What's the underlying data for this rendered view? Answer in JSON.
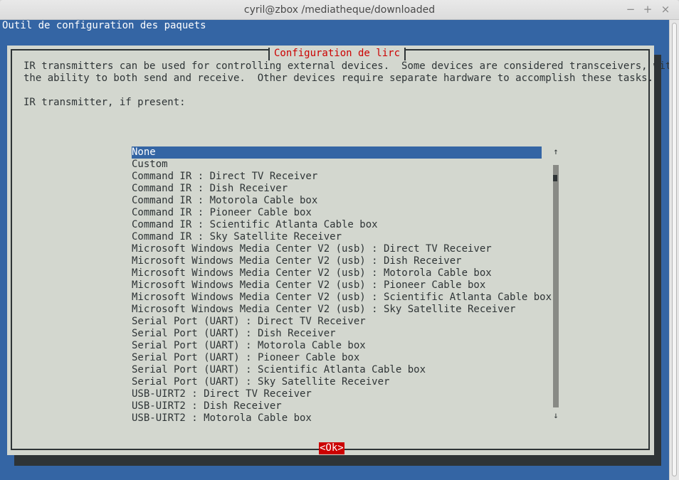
{
  "window": {
    "title": "cyril@zbox /mediatheque/downloaded",
    "min_icon": "−",
    "max_icon": "+",
    "close_icon": "×"
  },
  "terminal": {
    "header": "Outil de configuration des paquets"
  },
  "dialog": {
    "title": "Configuration de lirc",
    "description": "IR transmitters can be used for controlling external devices.  Some devices are considered transceivers, with\nthe ability to both send and receive.  Other devices require separate hardware to accomplish these tasks.\n\nIR transmitter, if present:",
    "items": [
      "None",
      "Custom",
      "Command IR : Direct TV Receiver",
      "Command IR : Dish Receiver",
      "Command IR : Motorola Cable box",
      "Command IR : Pioneer Cable box",
      "Command IR : Scientific Atlanta Cable box",
      "Command IR : Sky Satellite Receiver",
      "Microsoft Windows Media Center V2 (usb) : Direct TV Receiver",
      "Microsoft Windows Media Center V2 (usb) : Dish Receiver",
      "Microsoft Windows Media Center V2 (usb) : Motorola Cable box",
      "Microsoft Windows Media Center V2 (usb) : Pioneer Cable box",
      "Microsoft Windows Media Center V2 (usb) : Scientific Atlanta Cable box",
      "Microsoft Windows Media Center V2 (usb) : Sky Satellite Receiver",
      "Serial Port (UART) : Direct TV Receiver",
      "Serial Port (UART) : Dish Receiver",
      "Serial Port (UART) : Motorola Cable box",
      "Serial Port (UART) : Pioneer Cable box",
      "Serial Port (UART) : Scientific Atlanta Cable box",
      "Serial Port (UART) : Sky Satellite Receiver",
      "USB-UIRT2 : Direct TV Receiver",
      "USB-UIRT2 : Dish Receiver",
      "USB-UIRT2 : Motorola Cable box"
    ],
    "selected_index": 0,
    "scroll_up": "↑",
    "scroll_down": "↓",
    "ok_label": "<Ok>"
  },
  "colors": {
    "terminal_bg": "#3465a4",
    "dialog_bg": "#d3d7cf",
    "title_red": "#cc0000",
    "selected_bg": "#3465a4"
  }
}
